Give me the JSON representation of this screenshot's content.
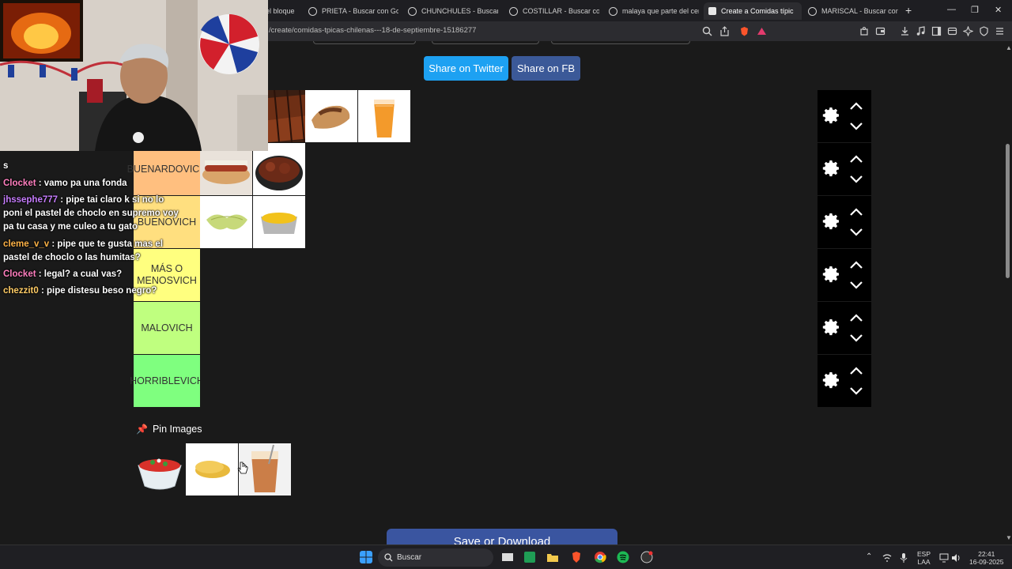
{
  "tabs": [
    {
      "title": "el bloque"
    },
    {
      "title": "PRIETA - Buscar con Goog"
    },
    {
      "title": "CHUNCHULES - Buscar co"
    },
    {
      "title": "COSTILLAR - Buscar con G"
    },
    {
      "title": "malaya que parte del cerd"
    },
    {
      "title": "Create a Comidas típic",
      "close": "✕"
    },
    {
      "title": "MARISCAL - Buscar con G"
    }
  ],
  "new_tab": "+",
  "window_controls": {
    "minimize": "—",
    "restore": "❐",
    "close": "✕"
  },
  "url": "/create/comidas-tpicas-chilenas---18-de-septiembre-15186277",
  "share": {
    "twitter": "Share on Twitter",
    "facebook": "Share on FB"
  },
  "tiers": [
    {
      "label": "",
      "color": "#ff7f7f"
    },
    {
      "label": "BUENARDOVICH",
      "color": "#ffbf7f"
    },
    {
      "label": "BUENOVICH",
      "color": "#ffdf7f"
    },
    {
      "label": "MÁS O MENOSVICH",
      "color": "#ffff7f"
    },
    {
      "label": "MALOVICH",
      "color": "#bfff7f"
    },
    {
      "label": "HORRIBLEVICH",
      "color": "#7fff7f"
    }
  ],
  "pin_images": {
    "heading": "Pin Images",
    "pin_icon": "pushpin-icon"
  },
  "save": {
    "label": "Save or Download"
  },
  "chat": [
    {
      "user": "",
      "text": "s",
      "color": "#ffffff"
    },
    {
      "user": "Clocket",
      "text": " : vamo pa una fonda",
      "color": "#ff7fbf"
    },
    {
      "user": "jhssephe777",
      "text": " : pipe tai claro k si no lo poni el pastel de choclo en supremo voy pa tu casa y me culeo a tu gato",
      "color": "#c77dff"
    },
    {
      "user": "cleme_v_v",
      "text": " : pipe que te gusta mas el pastel de choclo o las humitas?",
      "color": "#ffb347"
    },
    {
      "user": "Clocket",
      "text": " : legal? a cual vas?",
      "color": "#ff7fbf"
    },
    {
      "user": "chezzit0",
      "text": " : pipe distesu beso negro?",
      "color": "#ffcc66"
    }
  ],
  "taskbar": {
    "search_label": "Buscar",
    "lang_top": "ESP",
    "lang_bottom": "LAA",
    "time": "22:41",
    "date": "16-09-2025"
  }
}
